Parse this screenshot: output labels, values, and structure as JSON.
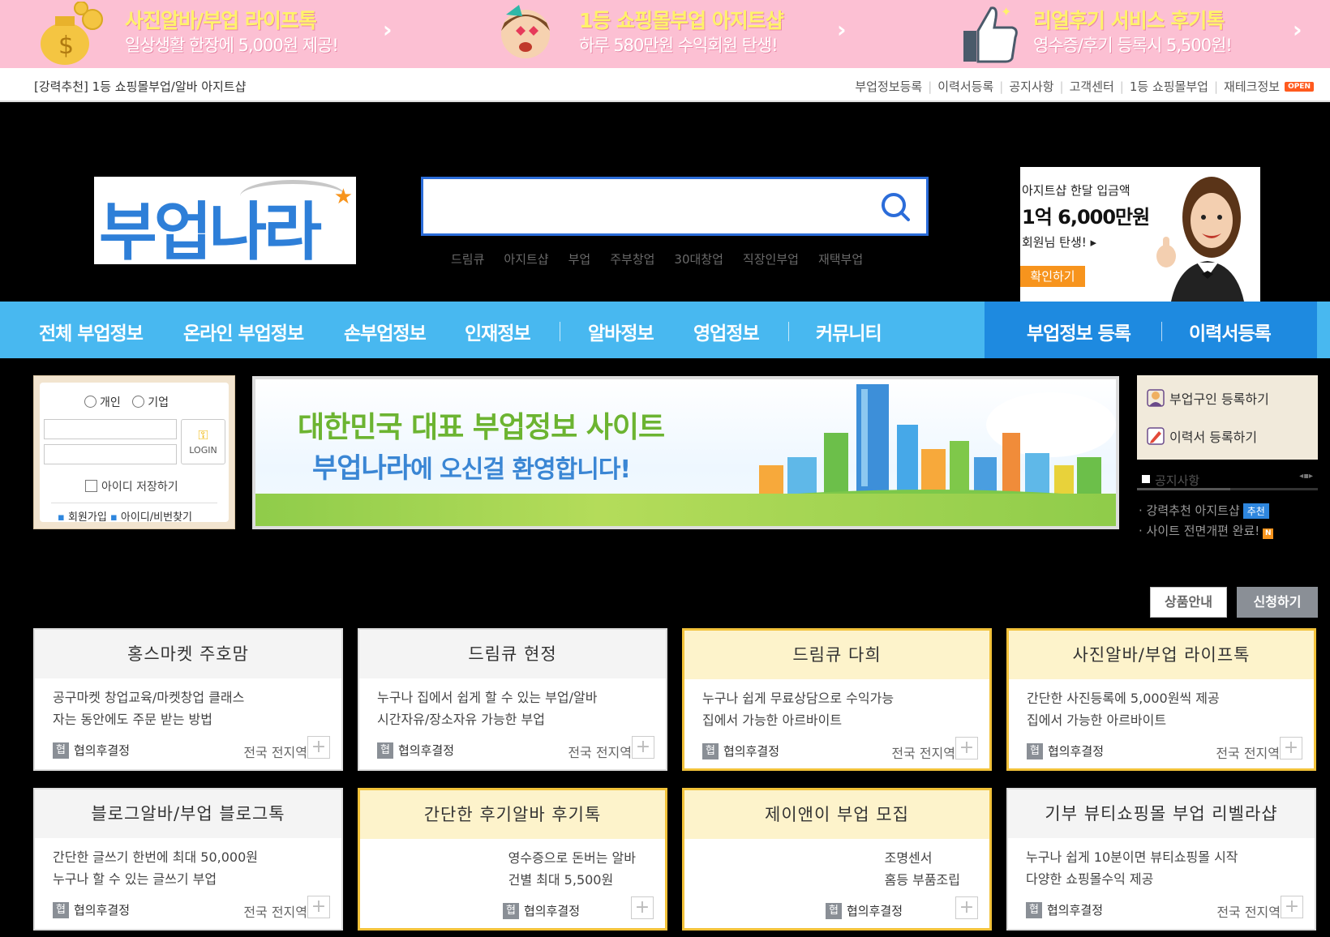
{
  "promo": [
    {
      "title": "사진알바/부업 라이프톡",
      "sub": "일상생활 한장에 5,000원 제공!",
      "arrow": "›",
      "icon": "money-bag-icon"
    },
    {
      "title": "1등 쇼핑몰부업 아지트샵",
      "sub": "하루 580만원 수익회원 탄생!",
      "arrow": "›",
      "icon": "girl-icon"
    },
    {
      "title": "리얼후기 서비스 후기톡",
      "sub": "영수증/후기 등록시 5,500원!",
      "arrow": "›",
      "icon": "thumbs-up-icon"
    }
  ],
  "util": {
    "left": "[강력추천] 1등 쇼핑몰부업/알바 아지트샵",
    "links": [
      "부업정보등록",
      "이력서등록",
      "공지사항",
      "고객센터",
      "1등 쇼핑몰부업",
      "재테크정보"
    ],
    "open_badge": "OPEN"
  },
  "logo": {
    "text": "부업나라",
    "star": "★"
  },
  "search": {
    "placeholder": "",
    "keywords": [
      "드림큐",
      "아지트샵",
      "부업",
      "주부창업",
      "30대창업",
      "직장인부업",
      "재택부업"
    ]
  },
  "ad": {
    "line1": "아지트샵 한달 입금액",
    "line2": "1억 6,000만원",
    "line3": "회원님 탄생! ▸",
    "button": "확인하기"
  },
  "nav": {
    "items": [
      "전체 부업정보",
      "온라인 부업정보",
      "손부업정보",
      "인재정보",
      "알바정보",
      "영업정보",
      "커뮤니티"
    ],
    "right": [
      "부업정보 등록",
      "이력서등록"
    ]
  },
  "login": {
    "radio_personal": "개인",
    "radio_company": "기업",
    "button": "LOGIN",
    "key_icon": "key-icon",
    "save_id": "아이디 저장하기",
    "join": "회원가입",
    "find": "아이디/비번찾기"
  },
  "welcome": {
    "line1": "대한민국 대표 부업정보 사이트",
    "line2_bold": "부업나라",
    "line2_rest": "에 오신걸 환영합니다!"
  },
  "quick": [
    {
      "label": "부업구인 등록하기",
      "icon": "person-icon"
    },
    {
      "label": "이력서 등록하기",
      "icon": "pencil-icon"
    }
  ],
  "notice": {
    "title": "공지사항",
    "items": [
      {
        "text": "강력추천 아지트샵",
        "tag": "추천"
      },
      {
        "text": "사이트 전면개편 완료!",
        "tag": "N"
      }
    ]
  },
  "product_buttons": {
    "info": "상품안내",
    "apply": "신청하기"
  },
  "cards": [
    {
      "title": "홍스마켓 주호맘",
      "desc": [
        "공구마켓 창업교육/마켓창업 클래스",
        "자는 동안에도 주문 받는 방법"
      ],
      "pay": "협의후결정",
      "pay_badge": "협",
      "region": "전국 전지역",
      "gold": false,
      "align": "left"
    },
    {
      "title": "드림큐 현정",
      "desc": [
        "누구나 집에서 쉽게 할 수 있는 부업/알바",
        "시간자유/장소자유 가능한 부업"
      ],
      "pay": "협의후결정",
      "pay_badge": "협",
      "region": "전국 전지역",
      "gold": false,
      "align": "left"
    },
    {
      "title": "드림큐 다희",
      "desc": [
        "누구나 쉽게 무료상담으로 수익가능",
        "집에서 가능한 아르바이트"
      ],
      "pay": "협의후결정",
      "pay_badge": "협",
      "region": "전국 전지역",
      "gold": true,
      "align": "left"
    },
    {
      "title": "사진알바/부업 라이프톡",
      "desc": [
        "간단한 사진등록에 5,000원씩 제공",
        "집에서 가능한 아르바이트"
      ],
      "pay": "협의후결정",
      "pay_badge": "협",
      "region": "전국 전지역",
      "gold": true,
      "align": "left"
    },
    {
      "title": "블로그알바/부업 블로그톡",
      "desc": [
        "간단한 글쓰기 한번에 최대 50,000원",
        "누구나 할 수 있는 글쓰기 부업"
      ],
      "pay": "협의후결정",
      "pay_badge": "협",
      "region": "전국 전지역",
      "gold": false,
      "align": "left"
    },
    {
      "title": "간단한 후기알바 후기톡",
      "desc": [
        "영수증으로 돈버는 알바",
        "건별 최대 5,500원"
      ],
      "pay": "협의후결정",
      "pay_badge": "협",
      "region": "",
      "gold": true,
      "align": "right"
    },
    {
      "title": "제이앤이 부업 모집",
      "desc": [
        "조명센서",
        "홈등 부품조립"
      ],
      "pay": "협의후결정",
      "pay_badge": "협",
      "region": "",
      "gold": true,
      "align": "right"
    },
    {
      "title": "기부 뷰티쇼핑몰 부업 리벨라샵",
      "desc": [
        "누구나 쉽게 10분이면 뷰티쇼핑몰 시작",
        "다양한 쇼핑몰수익 제공"
      ],
      "pay": "협의후결정",
      "pay_badge": "협",
      "region": "전국 전지역",
      "gold": false,
      "align": "left"
    }
  ],
  "plus": "+"
}
